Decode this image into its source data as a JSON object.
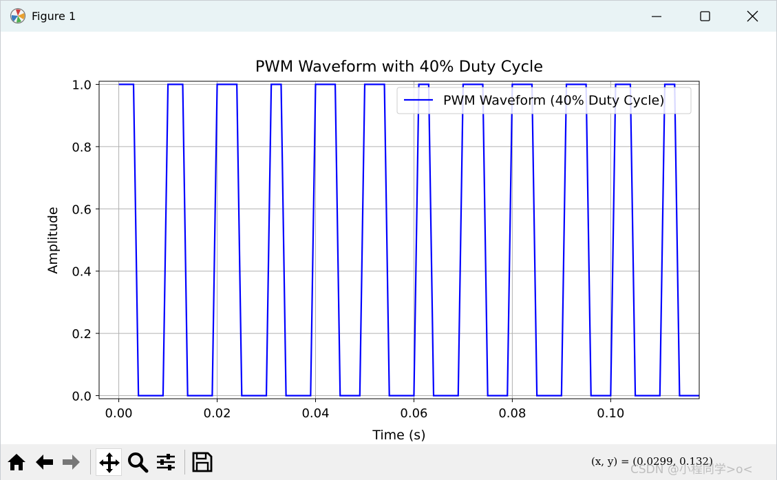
{
  "window": {
    "title": "Figure 1",
    "controls": {
      "minimize": "minimize",
      "maximize": "maximize",
      "close": "close"
    }
  },
  "toolbar": {
    "tools": [
      "home-icon",
      "back-arrow-icon",
      "forward-arrow-icon",
      "pan-move-icon",
      "zoom-magnifier-icon",
      "configure-sliders-icon",
      "save-floppy-icon"
    ],
    "active_tool": "pan-move-icon",
    "coordinate_readout": "(x, y) = (0.0299, 0.132)",
    "watermark": "CSDN @小程同学>o<"
  },
  "colors": {
    "series_line": "#0000ff",
    "grid": "#b0b0b0",
    "titlebar_bg": "#e9f3f5",
    "toolbar_bg": "#f0f0f0"
  },
  "chart_data": {
    "type": "line",
    "title": "PWM Waveform with 40% Duty Cycle",
    "xlabel": "Time (s)",
    "ylabel": "Amplitude",
    "xlim": [
      -0.004,
      0.118
    ],
    "ylim": [
      -0.01,
      1.01
    ],
    "xticks": [
      0.0,
      0.02,
      0.04,
      0.06,
      0.08,
      0.1
    ],
    "xtick_labels": [
      "0.00",
      "0.02",
      "0.04",
      "0.06",
      "0.08",
      "0.10"
    ],
    "yticks": [
      0.0,
      0.2,
      0.4,
      0.6,
      0.8,
      1.0
    ],
    "ytick_labels": [
      "0.0",
      "0.2",
      "0.4",
      "0.6",
      "0.8",
      "1.0"
    ],
    "grid": true,
    "legend_position": "upper right",
    "series": [
      {
        "name": "PWM Waveform (40% Duty Cycle)",
        "color": "#0000ff",
        "x": [
          0.0,
          0.003,
          0.004,
          0.009,
          0.01,
          0.013,
          0.014,
          0.019,
          0.02,
          0.024,
          0.025,
          0.03,
          0.031,
          0.033,
          0.034,
          0.039,
          0.04,
          0.044,
          0.045,
          0.049,
          0.05,
          0.054,
          0.055,
          0.06,
          0.061,
          0.063,
          0.064,
          0.069,
          0.07,
          0.074,
          0.075,
          0.079,
          0.08,
          0.084,
          0.085,
          0.09,
          0.091,
          0.095,
          0.096,
          0.1,
          0.101,
          0.104,
          0.105,
          0.11,
          0.111,
          0.113,
          0.114,
          0.118
        ],
        "y": [
          1,
          1,
          0,
          0,
          1,
          1,
          0,
          0,
          1,
          1,
          0,
          0,
          1,
          1,
          0,
          0,
          1,
          1,
          0,
          0,
          1,
          1,
          0,
          0,
          1,
          1,
          0,
          0,
          1,
          1,
          0,
          0,
          1,
          1,
          0,
          0,
          1,
          1,
          0,
          0,
          1,
          1,
          0,
          0,
          1,
          1,
          0,
          0
        ]
      }
    ]
  }
}
